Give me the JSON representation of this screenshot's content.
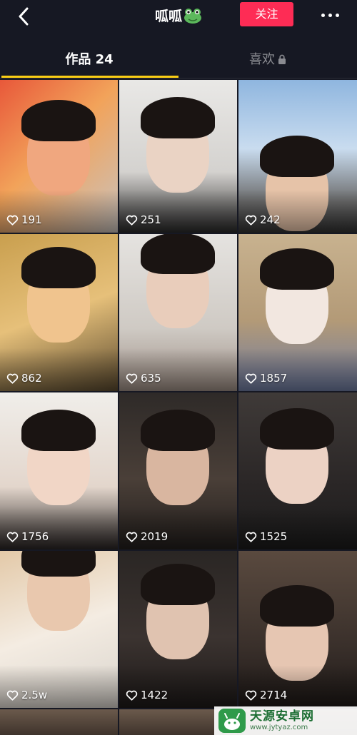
{
  "header": {
    "title": "呱呱",
    "title_emoji_icon": "frog-emoji-icon",
    "follow_label": "关注",
    "back_icon": "chevron-left-icon",
    "more_icon": "more-dots-icon"
  },
  "tabs": [
    {
      "label": "作品 24",
      "active": true
    },
    {
      "label": "喜欢",
      "locked": true,
      "lock_icon": "lock-icon"
    }
  ],
  "colors": {
    "background": "#161823",
    "accent": "#fe2c55",
    "tab_indicator": "#face15",
    "inactive_tab": "#8a8b91"
  },
  "videos": [
    {
      "likes": "191"
    },
    {
      "likes": "251"
    },
    {
      "likes": "242"
    },
    {
      "likes": "862"
    },
    {
      "likes": "635"
    },
    {
      "likes": "1857"
    },
    {
      "likes": "1756"
    },
    {
      "likes": "2019"
    },
    {
      "likes": "1525"
    },
    {
      "likes": "2.5w"
    },
    {
      "likes": "1422"
    },
    {
      "likes": "2714"
    }
  ],
  "watermark": {
    "name": "天源安卓网",
    "url": "www.jytyaz.com"
  }
}
